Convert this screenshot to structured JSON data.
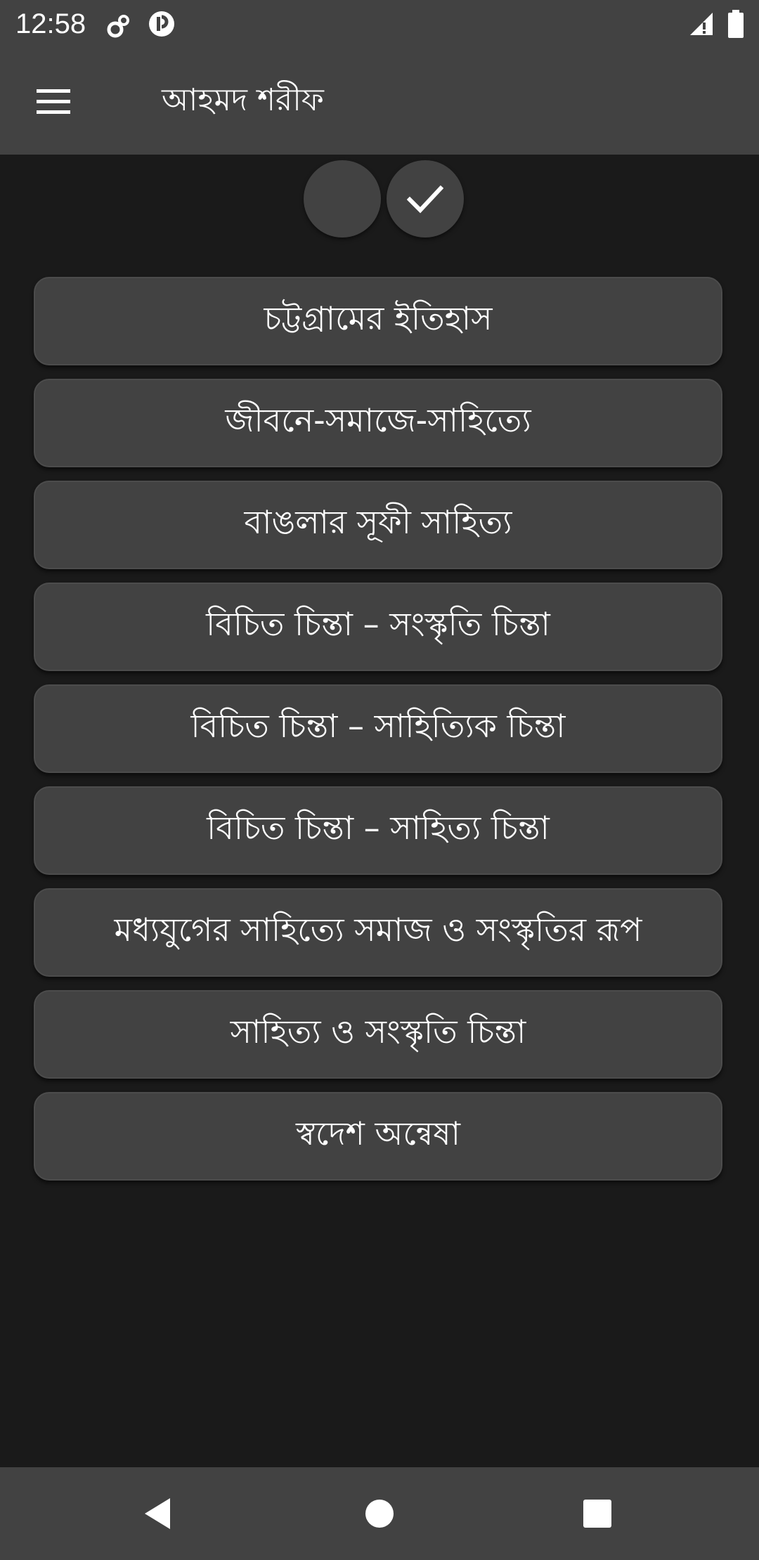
{
  "status_bar": {
    "time": "12:58",
    "icons": [
      "settings-icon",
      "notification-app-icon",
      "signal-icon",
      "battery-icon"
    ]
  },
  "app_bar": {
    "title": "আহমদ শরীফ",
    "menu_icon": "hamburger-menu-icon"
  },
  "toggles": [
    {
      "name": "option-unselected",
      "checked": false
    },
    {
      "name": "option-selected",
      "checked": true,
      "icon": "checkmark-icon"
    }
  ],
  "books": [
    {
      "label": "চট্টগ্রামের ইতিহাস"
    },
    {
      "label": "জীবনে-সমাজে-সাহিত্যে"
    },
    {
      "label": "বাঙলার সূফী সাহিত্য"
    },
    {
      "label": "বিচিত চিন্তা – সংস্কৃতি চিন্তা"
    },
    {
      "label": "বিচিত চিন্তা – সাহিত্যিক চিন্তা"
    },
    {
      "label": "বিচিত চিন্তা – সাহিত্য চিন্তা"
    },
    {
      "label": "মধ্যযুগের সাহিত্যে সমাজ ও সংস্কৃতির রূপ"
    },
    {
      "label": "সাহিত্য ও সংস্কৃতি চিন্তা"
    },
    {
      "label": "স্বদেশ অন্বেষা"
    }
  ],
  "nav_bar": {
    "icons": [
      "back-icon",
      "home-icon",
      "recents-icon"
    ]
  },
  "colors": {
    "background": "#1a1a1a",
    "surface": "#424242",
    "text": "#ffffff"
  }
}
